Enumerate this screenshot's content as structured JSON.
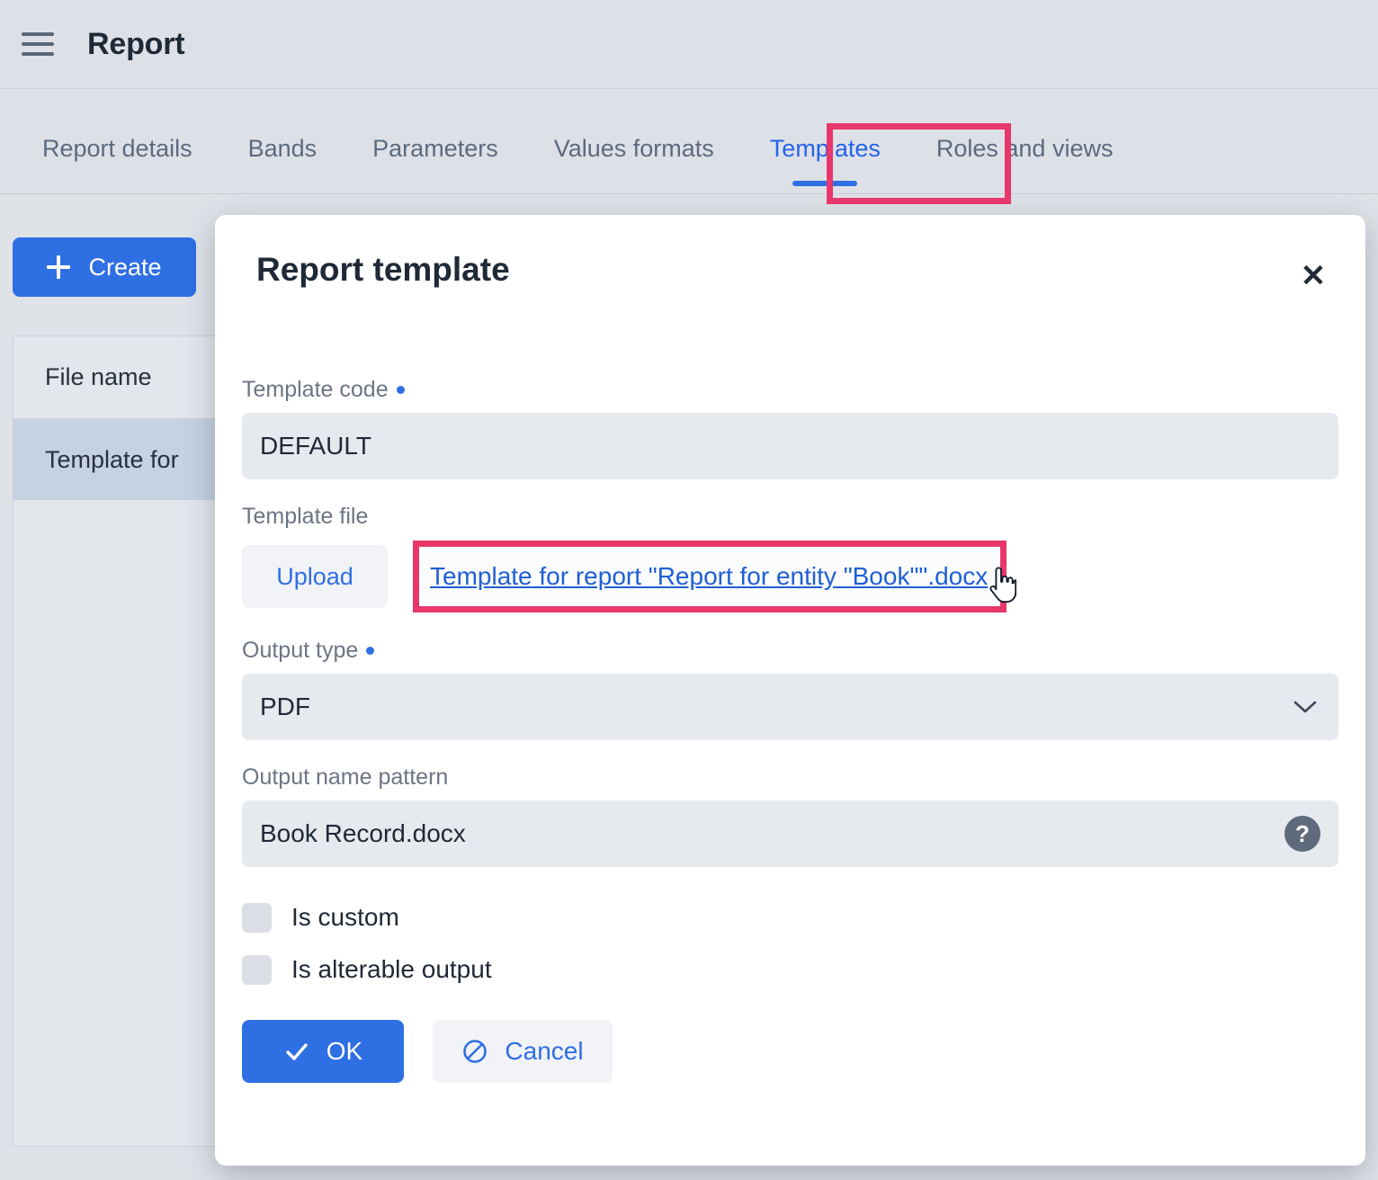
{
  "header": {
    "menu_icon": "hamburger-icon",
    "title": "Report"
  },
  "tabs": [
    {
      "label": "Report details",
      "active": false
    },
    {
      "label": "Bands",
      "active": false
    },
    {
      "label": "Parameters",
      "active": false
    },
    {
      "label": "Values formats",
      "active": false
    },
    {
      "label": "Templates",
      "active": true
    },
    {
      "label": "Roles and views",
      "active": false
    }
  ],
  "page": {
    "create_button": "Create",
    "create_icon": "plus-icon",
    "table": {
      "columns": [
        "File name"
      ],
      "rows": [
        {
          "file_name": "Template for",
          "selected": true
        }
      ]
    }
  },
  "dialog": {
    "title": "Report template",
    "close_icon": "close-icon",
    "template_code": {
      "label": "Template code",
      "required": true,
      "value": "DEFAULT"
    },
    "template_file": {
      "label": "Template file",
      "upload_button": "Upload",
      "file_link": "Template for report \"Report for entity \"Book\"\".docx",
      "cursor_icon": "pointing-hand-cursor"
    },
    "output_type": {
      "label": "Output type",
      "required": true,
      "value": "PDF",
      "chevron_icon": "chevron-down-icon",
      "options": [
        "PDF"
      ]
    },
    "output_name_pattern": {
      "label": "Output name pattern",
      "value": "Book Record.docx",
      "help_icon": "question-mark-icon",
      "help_glyph": "?"
    },
    "checkboxes": [
      {
        "label": "Is custom",
        "checked": false
      },
      {
        "label": "Is alterable output",
        "checked": false
      }
    ],
    "buttons": {
      "ok": "OK",
      "ok_icon": "check-icon",
      "cancel": "Cancel",
      "cancel_icon": "ban-circle-icon"
    }
  },
  "colors": {
    "accent_blue": "#2f6fe4",
    "highlight_pink": "#e8376b",
    "page_bg": "#dfe3e8",
    "input_bg": "#e6eaef",
    "label_grey": "#6c7584",
    "text_dark": "#202937"
  }
}
